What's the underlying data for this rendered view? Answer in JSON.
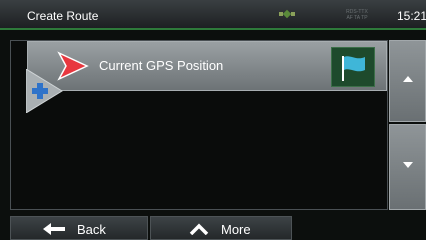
{
  "header": {
    "title": "Create Route",
    "rds": "RDS-TTX",
    "rds_sub": "AF TA TP",
    "time": "15:21",
    "gps_icon": "satellite-icon"
  },
  "route": {
    "items": [
      {
        "label": "Current GPS Position",
        "start_icon": "start-arrow-icon",
        "end_icon": "destination-flag-icon"
      }
    ],
    "add_icon": "plus-icon"
  },
  "scroll": {
    "up_icon": "arrow-up-icon",
    "down_icon": "arrow-down-icon"
  },
  "footer": {
    "back_label": "Back",
    "back_icon": "arrow-left-icon",
    "more_label": "More",
    "more_icon": "chevron-up-icon"
  },
  "colors": {
    "accent_green": "#2e7a3a",
    "start_red": "#e8373f",
    "flag_cyan": "#3fb6d8",
    "plus_blue": "#2f73c9"
  }
}
